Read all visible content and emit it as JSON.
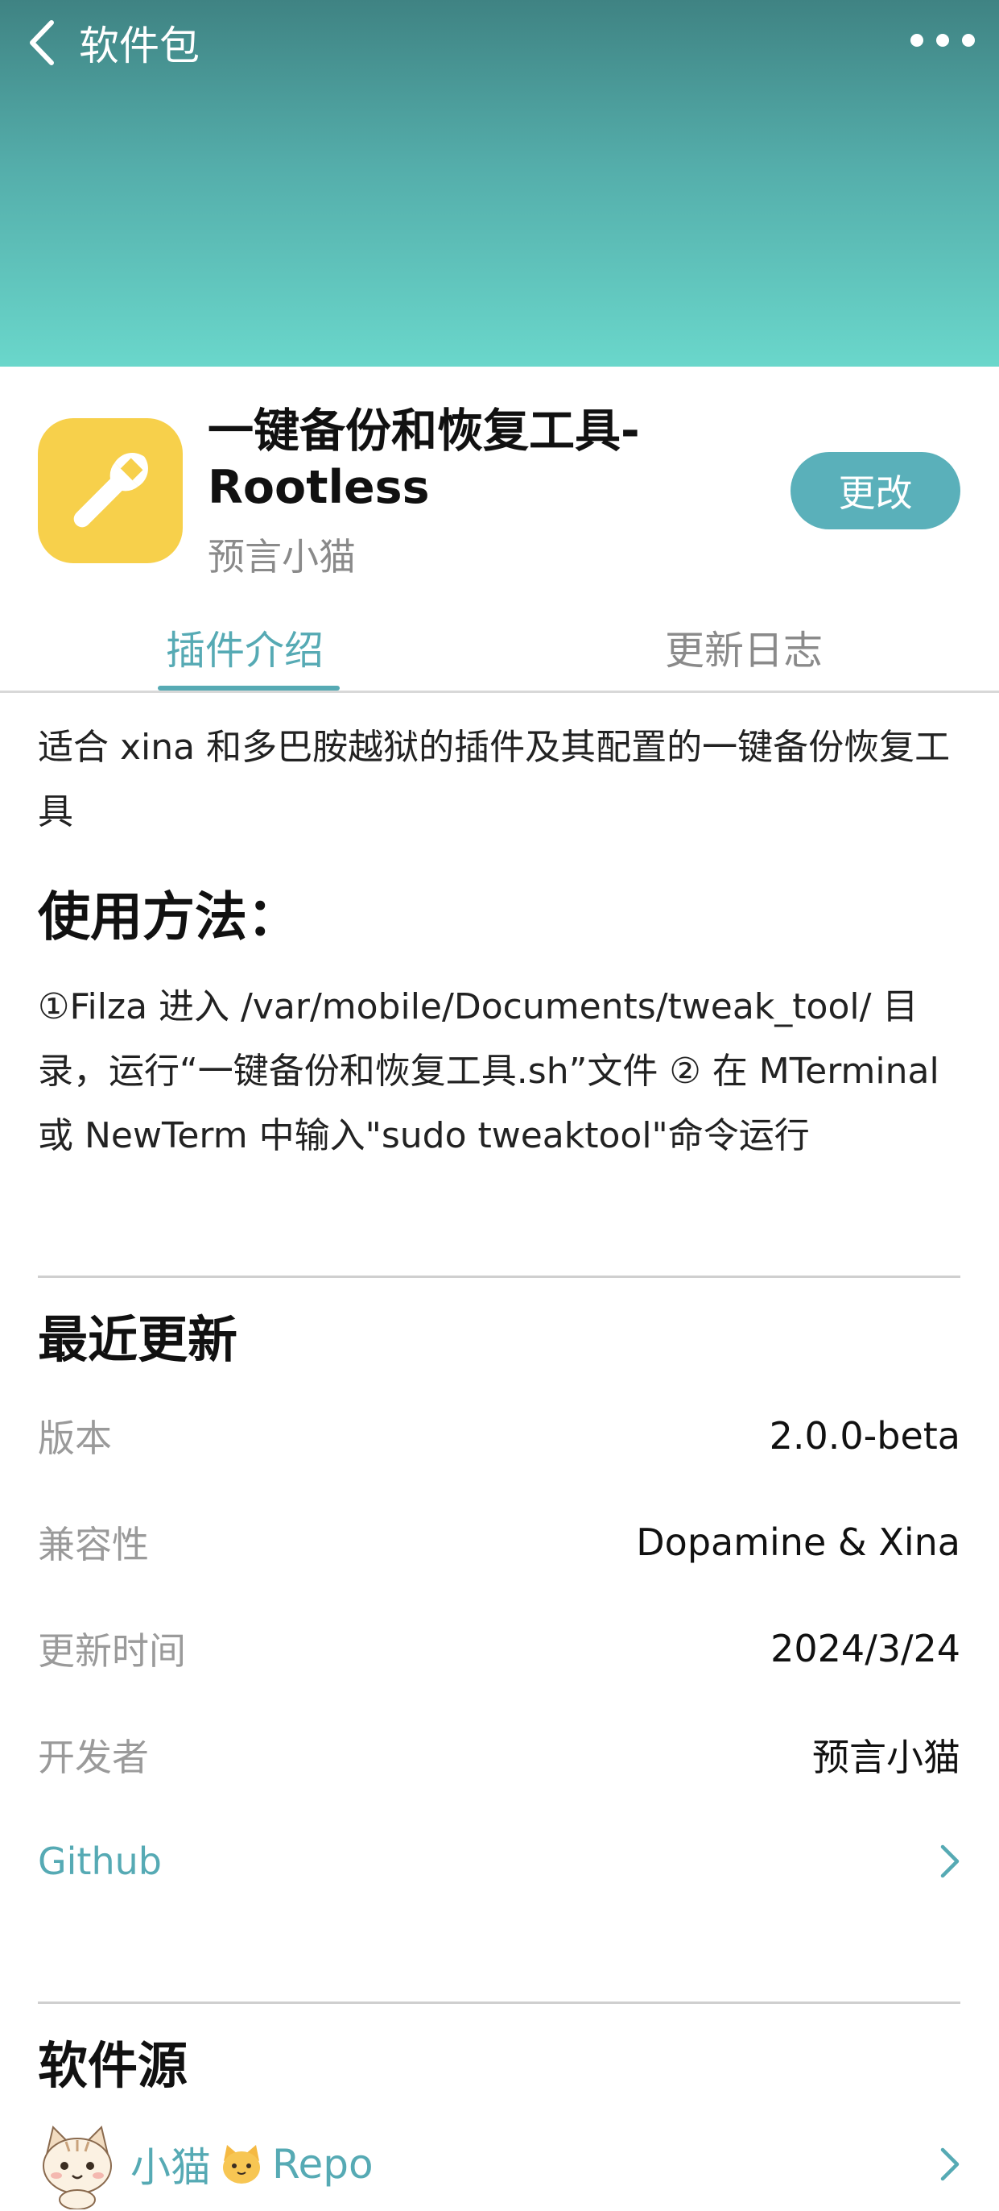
{
  "nav": {
    "back_label": "软件包"
  },
  "app": {
    "title_line1": "一键备份和恢复工具-",
    "title_line2": "Rootless",
    "developer": "预言小猫",
    "action_label": "更改",
    "icon": "wrench-icon",
    "icon_bg": "#f7d04b"
  },
  "tabs": [
    {
      "label": "插件介绍",
      "active": true
    },
    {
      "label": "更新日志",
      "active": false
    }
  ],
  "intro": {
    "description": "适合 xina 和多巴胺越狱的插件及其配置的一键备份恢复工具",
    "usage_heading": "使用方法：",
    "usage_text": "①Filza 进入 /var/mobile/Documents/tweak_tool/ 目录，运行“一键备份和恢复工具.sh”文件 ② 在 MTerminal 或 NewTerm 中输入\"sudo tweaktool\"命令运行"
  },
  "recent_update": {
    "heading": "最近更新",
    "rows": [
      {
        "label": "版本",
        "value": "2.0.0-beta"
      },
      {
        "label": "兼容性",
        "value": "Dopamine & Xina"
      },
      {
        "label": "更新时间",
        "value": "2024/3/24"
      },
      {
        "label": "开发者",
        "value": "预言小猫"
      }
    ],
    "link_label": "Github"
  },
  "source": {
    "heading": "软件源",
    "repo_prefix": "小猫",
    "repo_suffix": "Repo"
  },
  "colors": {
    "accent": "#56aab4",
    "header_top": "#3f8383",
    "header_bottom": "#6ad7cb"
  }
}
